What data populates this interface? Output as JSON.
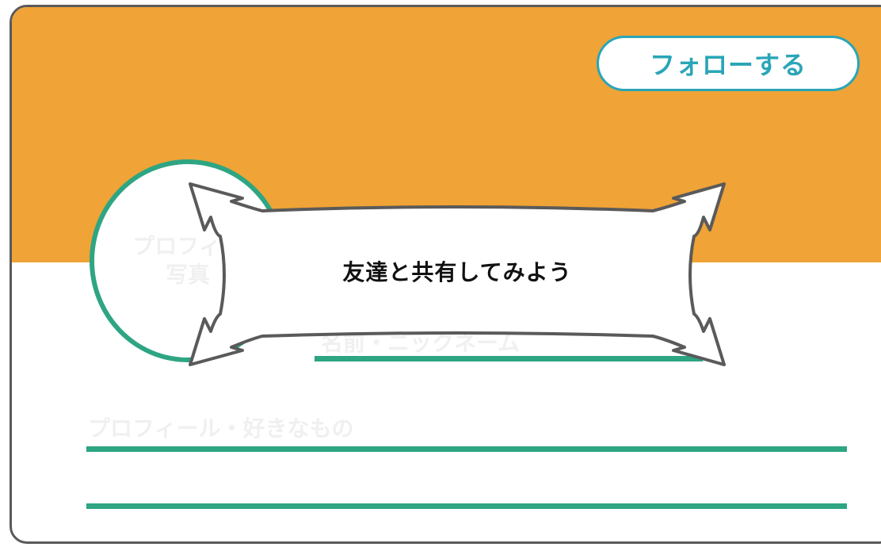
{
  "header": {
    "follow_label": "フォローする"
  },
  "profile_card": {
    "avatar_line1": "プロフィー",
    "avatar_line2": "写真",
    "name_label": "名前・ニックネーム",
    "profile_label": "プロフィール・好きなもの"
  },
  "banner": {
    "text": "友達と共有してみよう"
  },
  "colors": {
    "header": "#f0a336",
    "accent_green": "#2ea583",
    "follow_blue": "#2aa5b8",
    "border": "#5a5a5a"
  }
}
